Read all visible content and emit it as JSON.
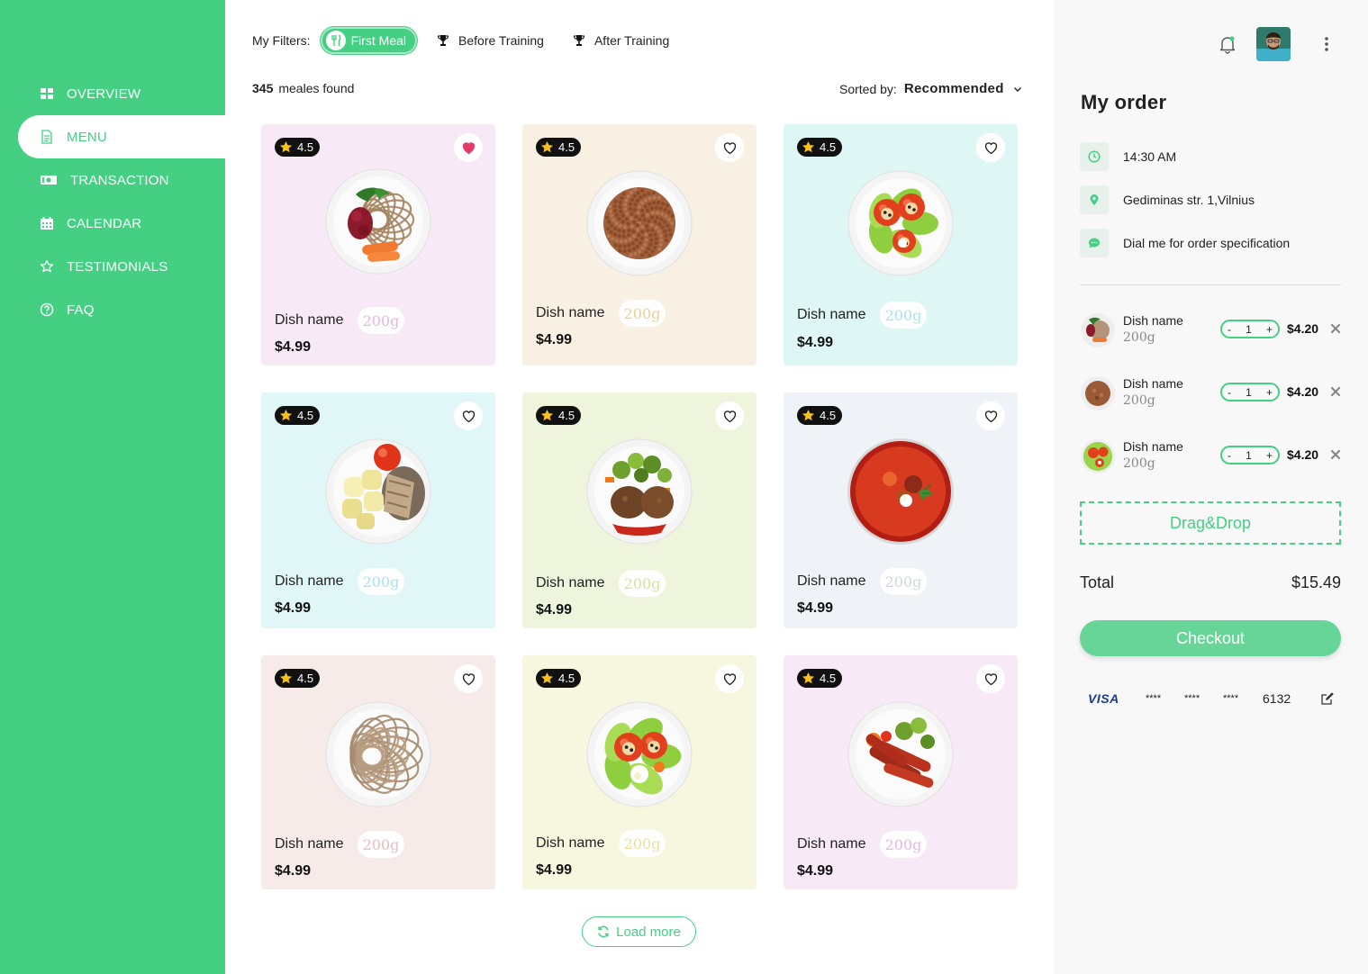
{
  "sidebar": {
    "items": [
      {
        "label": "OVERVIEW",
        "icon": "grid-icon"
      },
      {
        "label": "MENU",
        "icon": "document-icon",
        "active": true
      },
      {
        "label": "TRANSACTION",
        "icon": "money-icon"
      },
      {
        "label": "CALENDAR",
        "icon": "calendar-icon"
      },
      {
        "label": "TESTIMONIALS",
        "icon": "star-outline-icon"
      },
      {
        "label": "FAQ",
        "icon": "question-circle-icon"
      }
    ]
  },
  "filters": {
    "label": "My Filters:",
    "chips": [
      {
        "label": "First Meal",
        "icon": "cutlery-icon",
        "active": true
      },
      {
        "label": "Before Training",
        "icon": "trophy-icon",
        "active": false
      },
      {
        "label": "After Training",
        "icon": "trophy-icon",
        "active": false
      }
    ]
  },
  "results": {
    "count": "345",
    "label": "meales found"
  },
  "sort": {
    "label": "Sorted by:",
    "value": "Recommended"
  },
  "meals": [
    {
      "rating": "4.5",
      "name": "Dish name",
      "weight": "200g",
      "price": "$4.99",
      "favorite": true
    },
    {
      "rating": "4.5",
      "name": "Dish name",
      "weight": "200g",
      "price": "$4.99",
      "favorite": false
    },
    {
      "rating": "4.5",
      "name": "Dish name",
      "weight": "200g",
      "price": "$4.99",
      "favorite": false
    },
    {
      "rating": "4.5",
      "name": "Dish name",
      "weight": "200g",
      "price": "$4.99",
      "favorite": false
    },
    {
      "rating": "4.5",
      "name": "Dish name",
      "weight": "200g",
      "price": "$4.99",
      "favorite": false
    },
    {
      "rating": "4.5",
      "name": "Dish name",
      "weight": "200g",
      "price": "$4.99",
      "favorite": false
    },
    {
      "rating": "4.5",
      "name": "Dish name",
      "weight": "200g",
      "price": "$4.99",
      "favorite": false
    },
    {
      "rating": "4.5",
      "name": "Dish name",
      "weight": "200g",
      "price": "$4.99",
      "favorite": false
    },
    {
      "rating": "4.5",
      "name": "Dish name",
      "weight": "200g",
      "price": "$4.99",
      "favorite": false
    }
  ],
  "load_more": "Load more",
  "order": {
    "title": "My order",
    "time": "14:30 AM",
    "address": "Gediminas str. 1,Vilnius",
    "note": "Dial me for order specification",
    "items": [
      {
        "name": "Dish name",
        "weight": "200g",
        "qty": "1",
        "price": "$4.20"
      },
      {
        "name": "Dish name",
        "weight": "200g",
        "qty": "1",
        "price": "$4.20"
      },
      {
        "name": "Dish name",
        "weight": "200g",
        "qty": "1",
        "price": "$4.20"
      }
    ],
    "dropzone": "Drag&Drop",
    "total_label": "Total",
    "total_value": "$15.49",
    "checkout": "Checkout",
    "card": {
      "brand": "VISA",
      "mask": "****",
      "last4": "6132"
    }
  },
  "colors": {
    "accent": "#44cf83",
    "checkout": "#66d597",
    "favorite": "#e23c6b",
    "card_backgrounds": [
      "#f7e9f6",
      "#f8f0e2",
      "#def7f5",
      "#e1f6f6",
      "#eef5dc",
      "#eff3f7",
      "#f6ebe9",
      "#f7f6de",
      "#f7e9f6"
    ],
    "weight_text": [
      "#e6b8e0",
      "#e8cf99",
      "#a8e4ec",
      "#a8e4ec",
      "#d2e3a0",
      "#d0d7df",
      "#e8bcc0",
      "#e6e0a0",
      "#e6b8e0"
    ]
  }
}
